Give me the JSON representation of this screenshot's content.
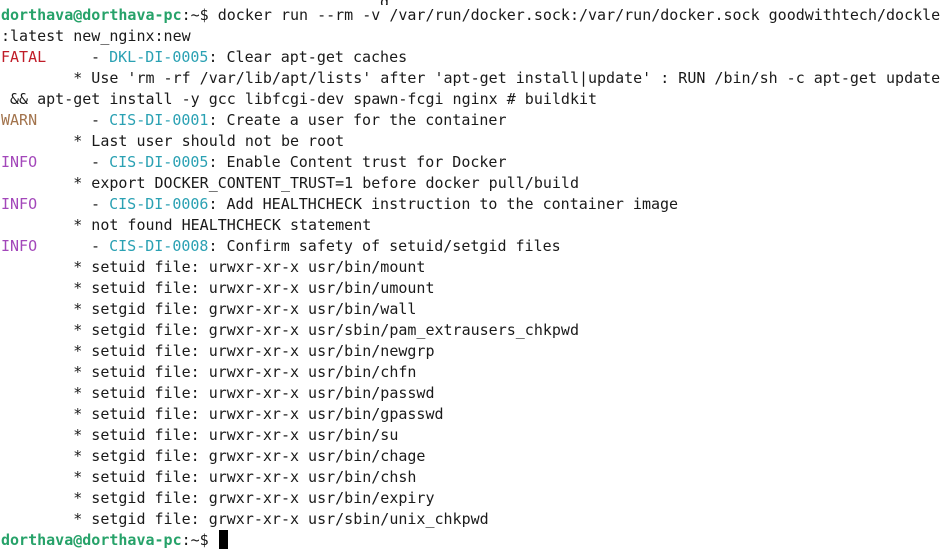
{
  "terminal": {
    "top_fragment": "g",
    "prompt": {
      "user_host": "dorthava@dorthava-pc",
      "path_suffix": ":~$ "
    },
    "command_line_1": "docker run --rm -v /var/run/docker.sock:/var/run/docker.sock goodwithtech/dockle",
    "command_line_2": ":latest new_nginx:new",
    "fatal": {
      "level": "FATAL",
      "sep": "  - ",
      "code": "DKL-DI-0005",
      "title": ": Clear apt-get caches",
      "detail_1": "        * Use 'rm -rf /var/lib/apt/lists' after 'apt-get install|update' : RUN /bin/sh -c apt-get update",
      "detail_2": " && apt-get install -y gcc libfcgi-dev spawn-fcgi nginx # buildkit"
    },
    "warn": {
      "level": "WARN",
      "sep": "  - ",
      "code": "CIS-DI-0001",
      "title": ": Create a user for the container",
      "detail": "        * Last user should not be root"
    },
    "info1": {
      "level": "INFO",
      "sep": "  - ",
      "code": "CIS-DI-0005",
      "title": ": Enable Content trust for Docker",
      "detail": "        * export DOCKER_CONTENT_TRUST=1 before docker pull/build"
    },
    "info2": {
      "level": "INFO",
      "sep": "  - ",
      "code": "CIS-DI-0006",
      "title": ": Add HEALTHCHECK instruction to the container image",
      "detail": "        * not found HEALTHCHECK statement"
    },
    "info3": {
      "level": "INFO",
      "sep": "  - ",
      "code": "CIS-DI-0008",
      "title": ": Confirm safety of setuid/setgid files",
      "details": [
        "        * setuid file: urwxr-xr-x usr/bin/mount",
        "        * setuid file: urwxr-xr-x usr/bin/umount",
        "        * setgid file: grwxr-xr-x usr/bin/wall",
        "        * setgid file: grwxr-xr-x usr/sbin/pam_extrausers_chkpwd",
        "        * setuid file: urwxr-xr-x usr/bin/newgrp",
        "        * setuid file: urwxr-xr-x usr/bin/chfn",
        "        * setuid file: urwxr-xr-x usr/bin/passwd",
        "        * setuid file: urwxr-xr-x usr/bin/gpasswd",
        "        * setuid file: urwxr-xr-x usr/bin/su",
        "        * setgid file: grwxr-xr-x usr/bin/chage",
        "        * setuid file: urwxr-xr-x usr/bin/chsh",
        "        * setgid file: grwxr-xr-x usr/bin/expiry",
        "        * setgid file: grwxr-xr-x usr/sbin/unix_chkpwd"
      ]
    },
    "colors": {
      "prompt_user": "#26a269",
      "fatal": "#c01c28",
      "warn": "#a2734c",
      "info": "#a347ba",
      "code": "#2aa1b3"
    }
  }
}
